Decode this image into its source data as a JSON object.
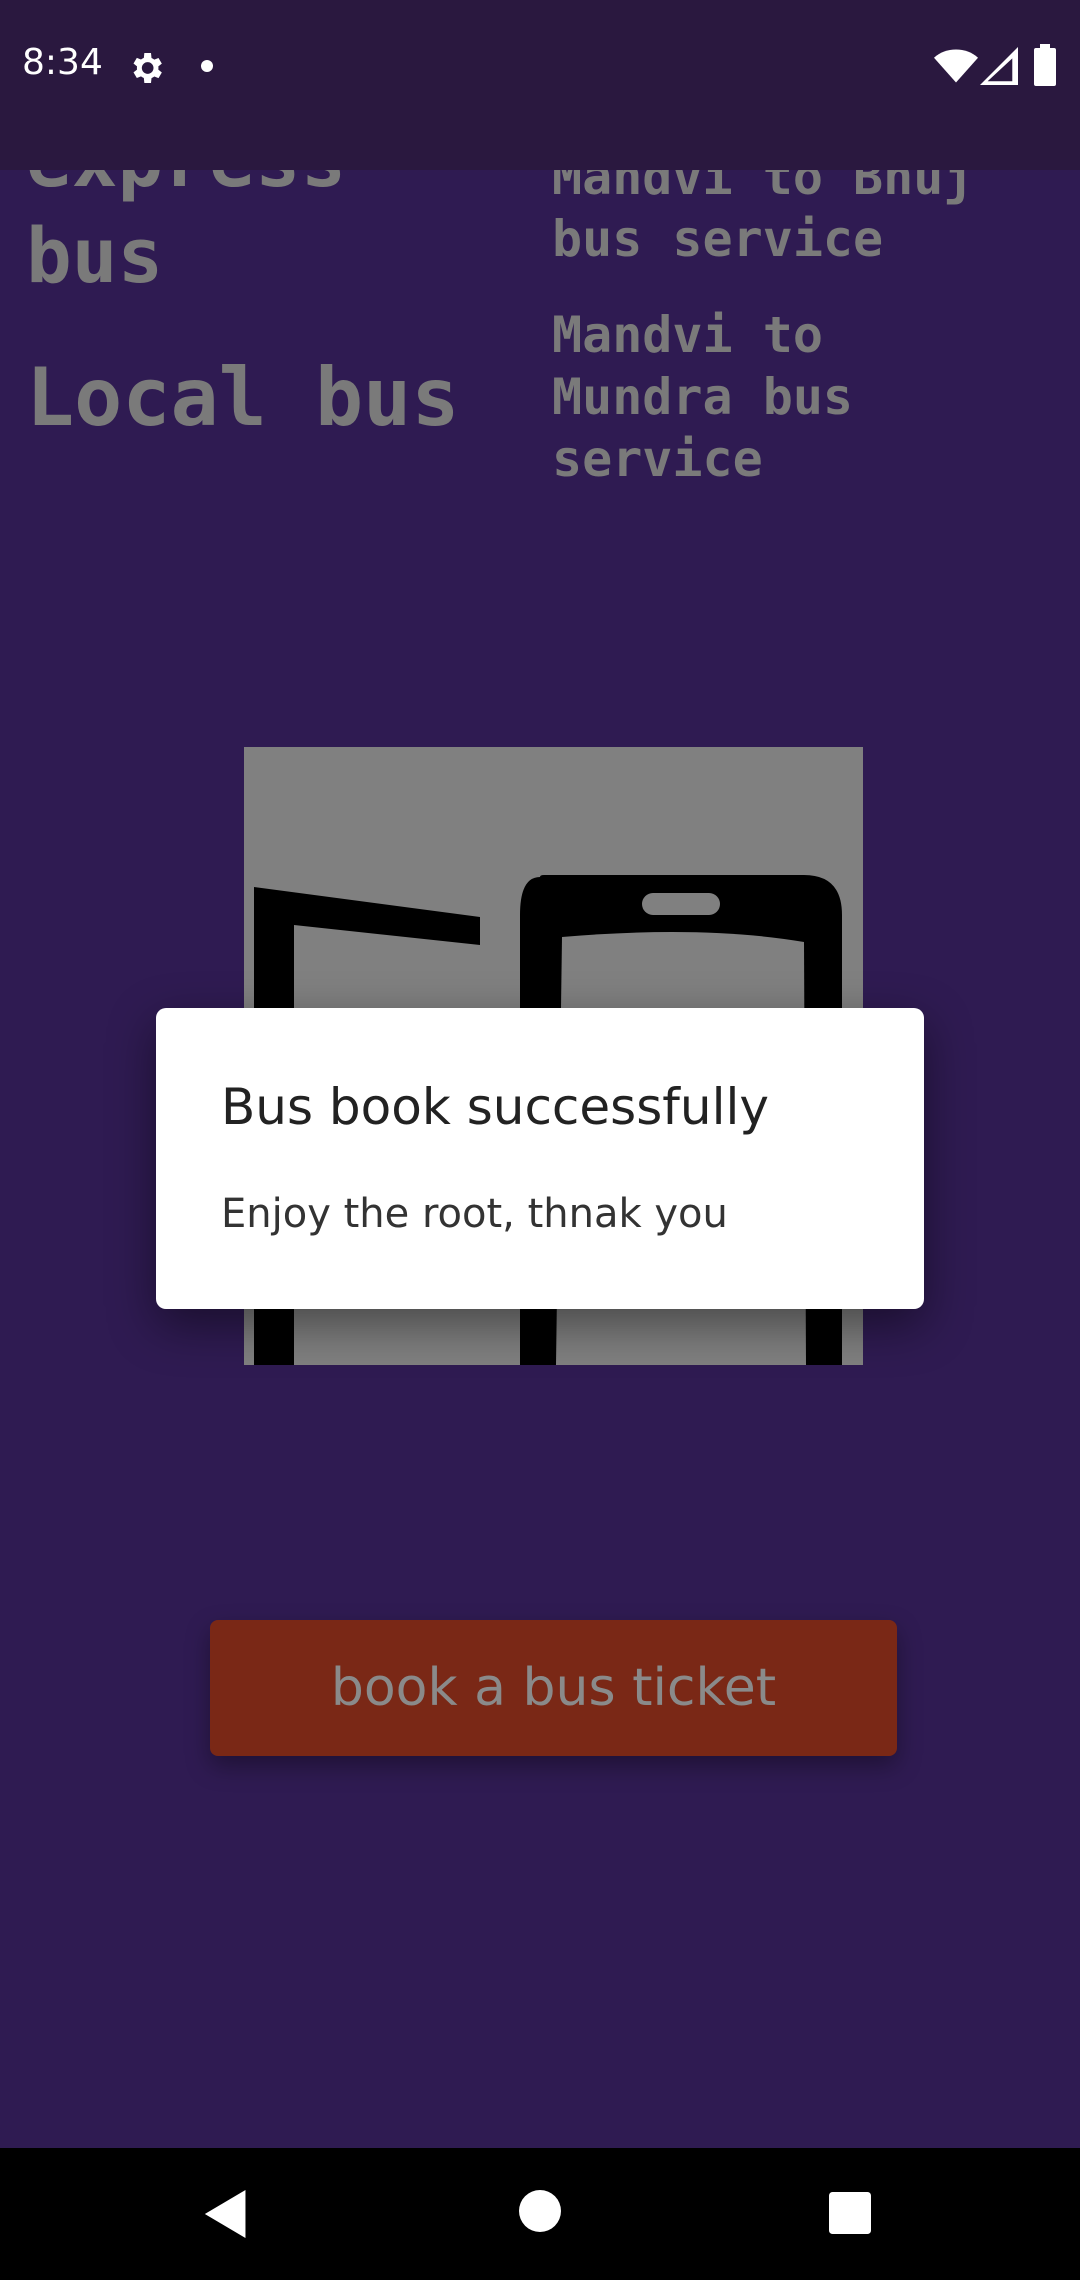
{
  "status_bar": {
    "time": "8:34",
    "icons": [
      "gear-icon",
      "notification-dot-icon",
      "wifi-icon",
      "signal-icon",
      "battery-icon"
    ]
  },
  "labels": {
    "express_bus": "express\nbus",
    "local_bus": "Local bus",
    "mandvi_bhuj": "Mandvi to Bhuj\nbus service",
    "mandvi_mundra": "Mandvi to\nMundra bus\nservice"
  },
  "image": {
    "icon": "bus-phone-icon"
  },
  "button": {
    "label": "book a bus ticket"
  },
  "dialog": {
    "title": "Bus book successfully",
    "message": "Enjoy the root, thnak you"
  },
  "nav_bar": {
    "icons": [
      "back-icon",
      "home-icon",
      "recents-icon"
    ]
  },
  "colors": {
    "background": "#2f1b52",
    "status_bar": "#2a183f",
    "button": "#7a2816",
    "label_text": "#7a7a7a"
  }
}
